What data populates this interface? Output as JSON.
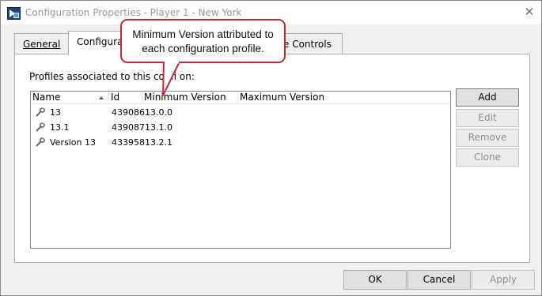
{
  "window": {
    "title": "Configuration Properties - Player 1 - New York"
  },
  "tabs": [
    {
      "label": "General",
      "active": false
    },
    {
      "label": "Configurati",
      "active": true
    },
    {
      "label": "e Controls",
      "active": false
    }
  ],
  "panel": {
    "label": "Profiles associated to this confi    on:"
  },
  "list": {
    "columns": [
      "Name",
      "Id",
      "Minimum Version",
      "Maximum Version"
    ],
    "sorted_column": "Name",
    "rows": [
      {
        "name": "13",
        "id": "439086",
        "min": "13.0.0",
        "max": ""
      },
      {
        "name": "13.1",
        "id": "439087",
        "min": "13.1.0",
        "max": ""
      },
      {
        "name": "Version 13",
        "id": "433958",
        "min": "13.2.1",
        "max": ""
      }
    ]
  },
  "side_buttons": {
    "add": "Add",
    "edit": "Edit",
    "remove": "Remove",
    "clone": "Clone"
  },
  "bottom_buttons": {
    "ok": "OK",
    "cancel": "Cancel",
    "apply": "Apply"
  },
  "callout": {
    "line1": "Minimum Version attributed to",
    "line2": "each configuration profile."
  },
  "icons": {
    "app": "app-logo-icon",
    "close": "close-icon",
    "row": "wrench-icon",
    "sort": "sort-ascending-icon"
  },
  "colors": {
    "callout_border": "#c4293a"
  }
}
